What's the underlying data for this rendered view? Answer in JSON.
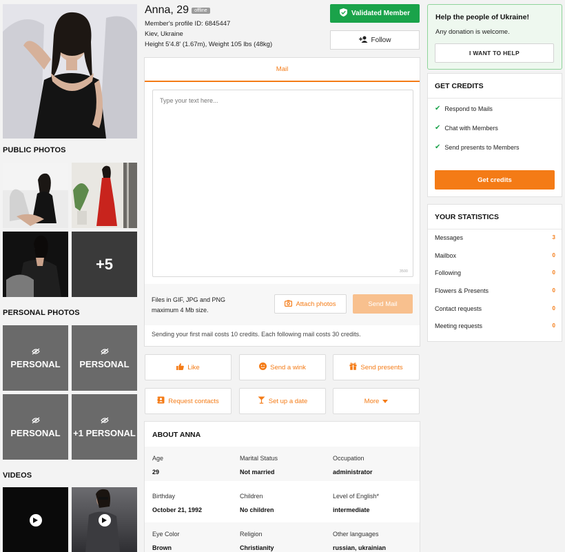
{
  "profile": {
    "name": "Anna, 29",
    "status": "offline",
    "profile_id": "Member's profile ID: 6845447",
    "location": "Kiev, Ukraine",
    "height_weight": "Height 5'4.8' (1.67m), Weight 105 lbs (48kg)"
  },
  "header_buttons": {
    "validated": "Validated Member",
    "follow": "Follow"
  },
  "left": {
    "public_photos_title": "PUBLIC PHOTOS",
    "more_photos": "+5",
    "personal_photos_title": "PERSONAL PHOTOS",
    "personal_label": "PERSONAL",
    "personal_more": "+1 PERSONAL",
    "videos_title": "VIDEOS"
  },
  "mail": {
    "tab": "Mail",
    "placeholder": "Type your text here...",
    "char_limit": "3500",
    "files_note_1": "Files in GIF, JPG and PNG",
    "files_note_2": "maximum 4 Mb size.",
    "attach_label": "Attach photos",
    "send_label": "Send Mail",
    "cost_note": "Sending your first mail costs 10 credits. Each following mail costs 30 credits."
  },
  "actions": [
    {
      "label": "Like",
      "icon": "thumbs-up-icon"
    },
    {
      "label": "Send a wink",
      "icon": "wink-icon"
    },
    {
      "label": "Send presents",
      "icon": "gift-icon"
    },
    {
      "label": "Request contacts",
      "icon": "contact-card-icon"
    },
    {
      "label": "Set up a date",
      "icon": "cocktail-icon"
    },
    {
      "label": "More",
      "icon": "caret-down-icon"
    }
  ],
  "about": {
    "title": "ABOUT ANNA",
    "rows": [
      [
        {
          "label": "Age",
          "value": "29"
        },
        {
          "label": "Marital Status",
          "value": "Not married"
        },
        {
          "label": "Occupation",
          "value": "administrator"
        }
      ],
      [
        {
          "label": "Birthday",
          "value": "October 21, 1992"
        },
        {
          "label": "Children",
          "value": "No children"
        },
        {
          "label": "Level of English*",
          "value": "intermediate"
        }
      ],
      [
        {
          "label": "Eye Color",
          "value": "Brown"
        },
        {
          "label": "Religion",
          "value": "Christianity"
        },
        {
          "label": "Other languages",
          "value": "russian, ukrainian"
        }
      ]
    ]
  },
  "ukraine": {
    "title": "Help the people of Ukraine!",
    "text": "Any donation is welcome.",
    "button": "I WANT TO HELP"
  },
  "credits": {
    "title": "GET CREDITS",
    "features": [
      "Respond to Mails",
      "Chat with Members",
      "Send presents to Members"
    ],
    "button": "Get credits"
  },
  "statistics": {
    "title": "YOUR STATISTICS",
    "items": [
      {
        "label": "Messages",
        "value": "3"
      },
      {
        "label": "Mailbox",
        "value": "0"
      },
      {
        "label": "Following",
        "value": "0"
      },
      {
        "label": "Flowers & Presents",
        "value": "0"
      },
      {
        "label": "Contact requests",
        "value": "0"
      },
      {
        "label": "Meeting requests",
        "value": "0"
      }
    ]
  },
  "colors": {
    "accent": "#f47b16",
    "validated": "#1aa34a",
    "ukraine_border": "#8fd39a"
  }
}
